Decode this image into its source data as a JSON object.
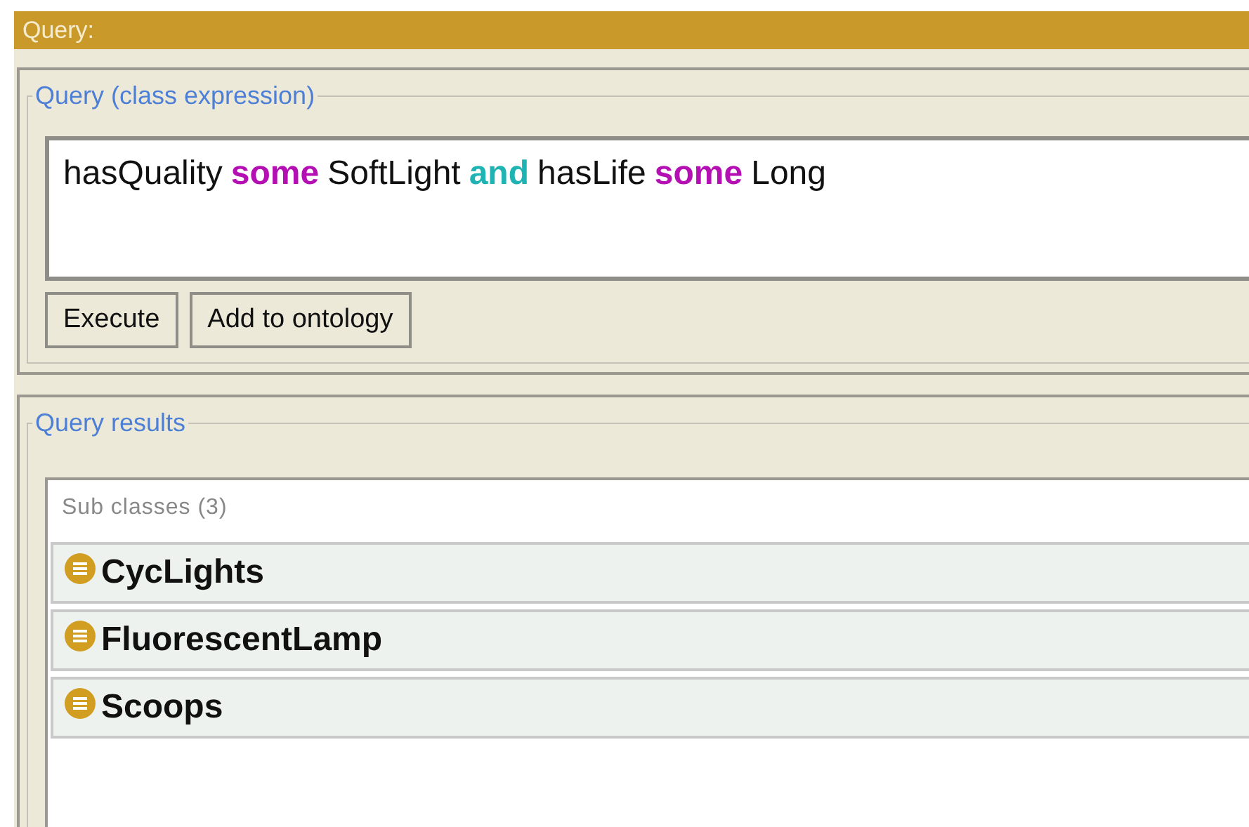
{
  "header": {
    "title": "Query:"
  },
  "query_panel": {
    "legend": "Query (class expression)",
    "expression": [
      {
        "text": "hasQuality",
        "kind": "name"
      },
      {
        "text": "some",
        "kind": "keyword"
      },
      {
        "text": "SoftLight",
        "kind": "name"
      },
      {
        "text": "and",
        "kind": "connective"
      },
      {
        "text": "hasLife",
        "kind": "name"
      },
      {
        "text": "some",
        "kind": "keyword"
      },
      {
        "text": "Long",
        "kind": "name"
      }
    ],
    "buttons": [
      "Execute",
      "Add to ontology"
    ]
  },
  "results_panel": {
    "legend": "Query results",
    "section": "Sub classes (3)",
    "items": [
      {
        "label": "CycLights"
      },
      {
        "label": "FluorescentLamp"
      },
      {
        "label": "Scoops"
      }
    ]
  }
}
